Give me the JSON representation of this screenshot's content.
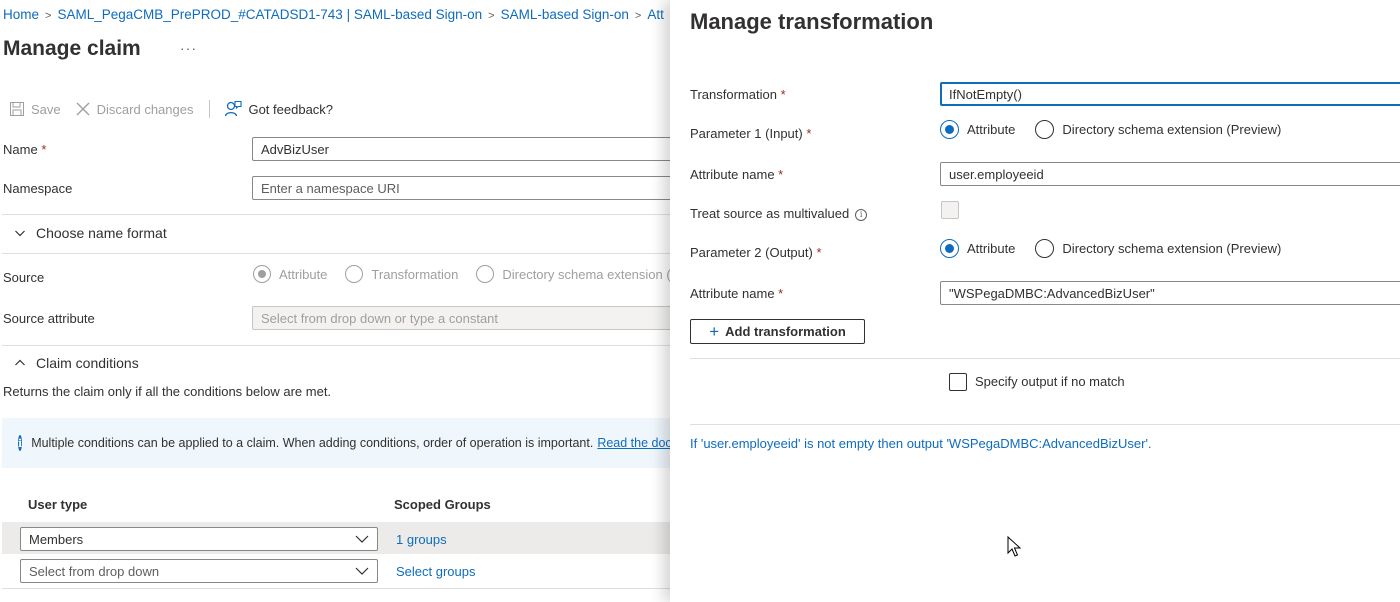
{
  "breadcrumb": {
    "items": [
      "Home",
      "SAML_PegaCMB_PrePROD_#CATADSD1-743 | SAML-based Sign-on",
      "SAML-based Sign-on",
      "Att"
    ]
  },
  "page": {
    "title": "Manage claim",
    "more": "···"
  },
  "toolbar": {
    "save": "Save",
    "discard": "Discard changes",
    "feedback": "Got feedback?"
  },
  "form": {
    "name_label": "Name",
    "name_value": "AdvBizUser",
    "namespace_label": "Namespace",
    "namespace_placeholder": "Enter a namespace URI",
    "name_format_section": "Choose name format",
    "source_label": "Source",
    "source_options": [
      "Attribute",
      "Transformation",
      "Directory schema extension (Pr"
    ],
    "source_attr_label": "Source attribute",
    "source_attr_placeholder": "Select from drop down or type a constant",
    "required_marker": "*"
  },
  "conditions": {
    "section": "Claim conditions",
    "desc": "Returns the claim only if all the conditions below are met.",
    "info_text": "Multiple conditions can be applied to a claim.  When adding conditions, order of operation is important.",
    "info_link": "Read the docu",
    "col_user_type": "User type",
    "col_scoped_groups": "Scoped Groups",
    "rows": [
      {
        "user_type": "Members",
        "groups": "1 groups"
      },
      {
        "user_type": "Select from drop down",
        "groups": "Select groups"
      }
    ]
  },
  "panel": {
    "title": "Manage transformation",
    "transformation_label": "Transformation",
    "transformation_value": "IfNotEmpty()",
    "param1_label": "Parameter 1 (Input)",
    "param_options": [
      "Attribute",
      "Directory schema extension (Preview)"
    ],
    "attr_name_label": "Attribute name",
    "attr_name_1": "user.employeeid",
    "treat_multivalued_label": "Treat source as multivalued",
    "param2_label": "Parameter 2 (Output)",
    "attr_name_2": "\"WSPegaDMBC:AdvancedBizUser\"",
    "add_transformation": "Add transformation",
    "specify_output": "Specify output if no match",
    "summary": "If 'user.employeeid' is not empty then output 'WSPegaDMBC:AdvancedBizUser'.",
    "required_marker": "*"
  },
  "colors": {
    "accent": "#0f6cbd",
    "required": "#a4262c",
    "info_bg": "#eff6fc"
  }
}
